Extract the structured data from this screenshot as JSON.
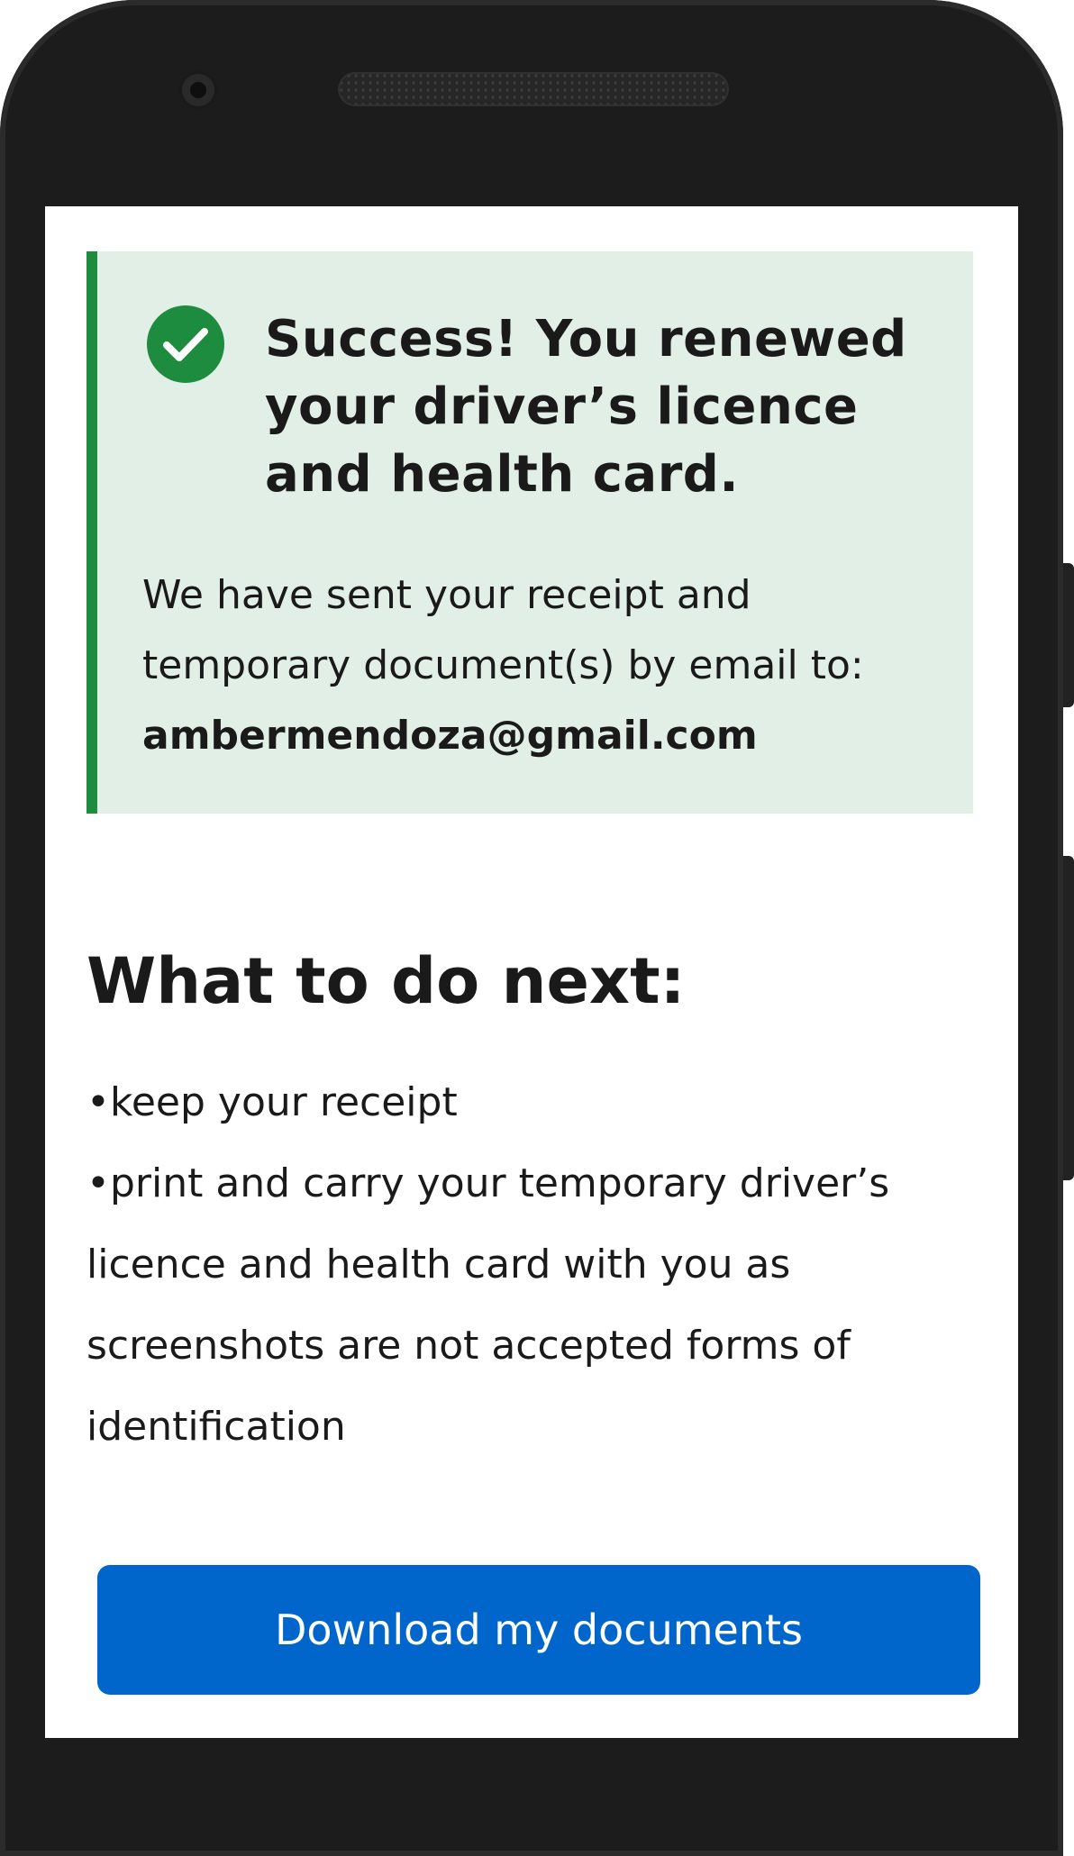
{
  "alert": {
    "title": "Success! You renewed your driver’s licence and health card.",
    "message": "We have sent your receipt and temporary document(s) by email to:",
    "email": "ambermendoza@gmail.com",
    "icon": "check-circle-icon",
    "accent_color": "#1e8c3e",
    "background_color": "#e1efe6"
  },
  "next_steps": {
    "heading": "What to do next:",
    "items": [
      "keep your receipt",
      "print and carry your temporary driver’s licence and health card with you as screenshots are not accepted forms of identification"
    ]
  },
  "actions": {
    "download_label": "Download my documents",
    "button_color": "#0066cc"
  }
}
